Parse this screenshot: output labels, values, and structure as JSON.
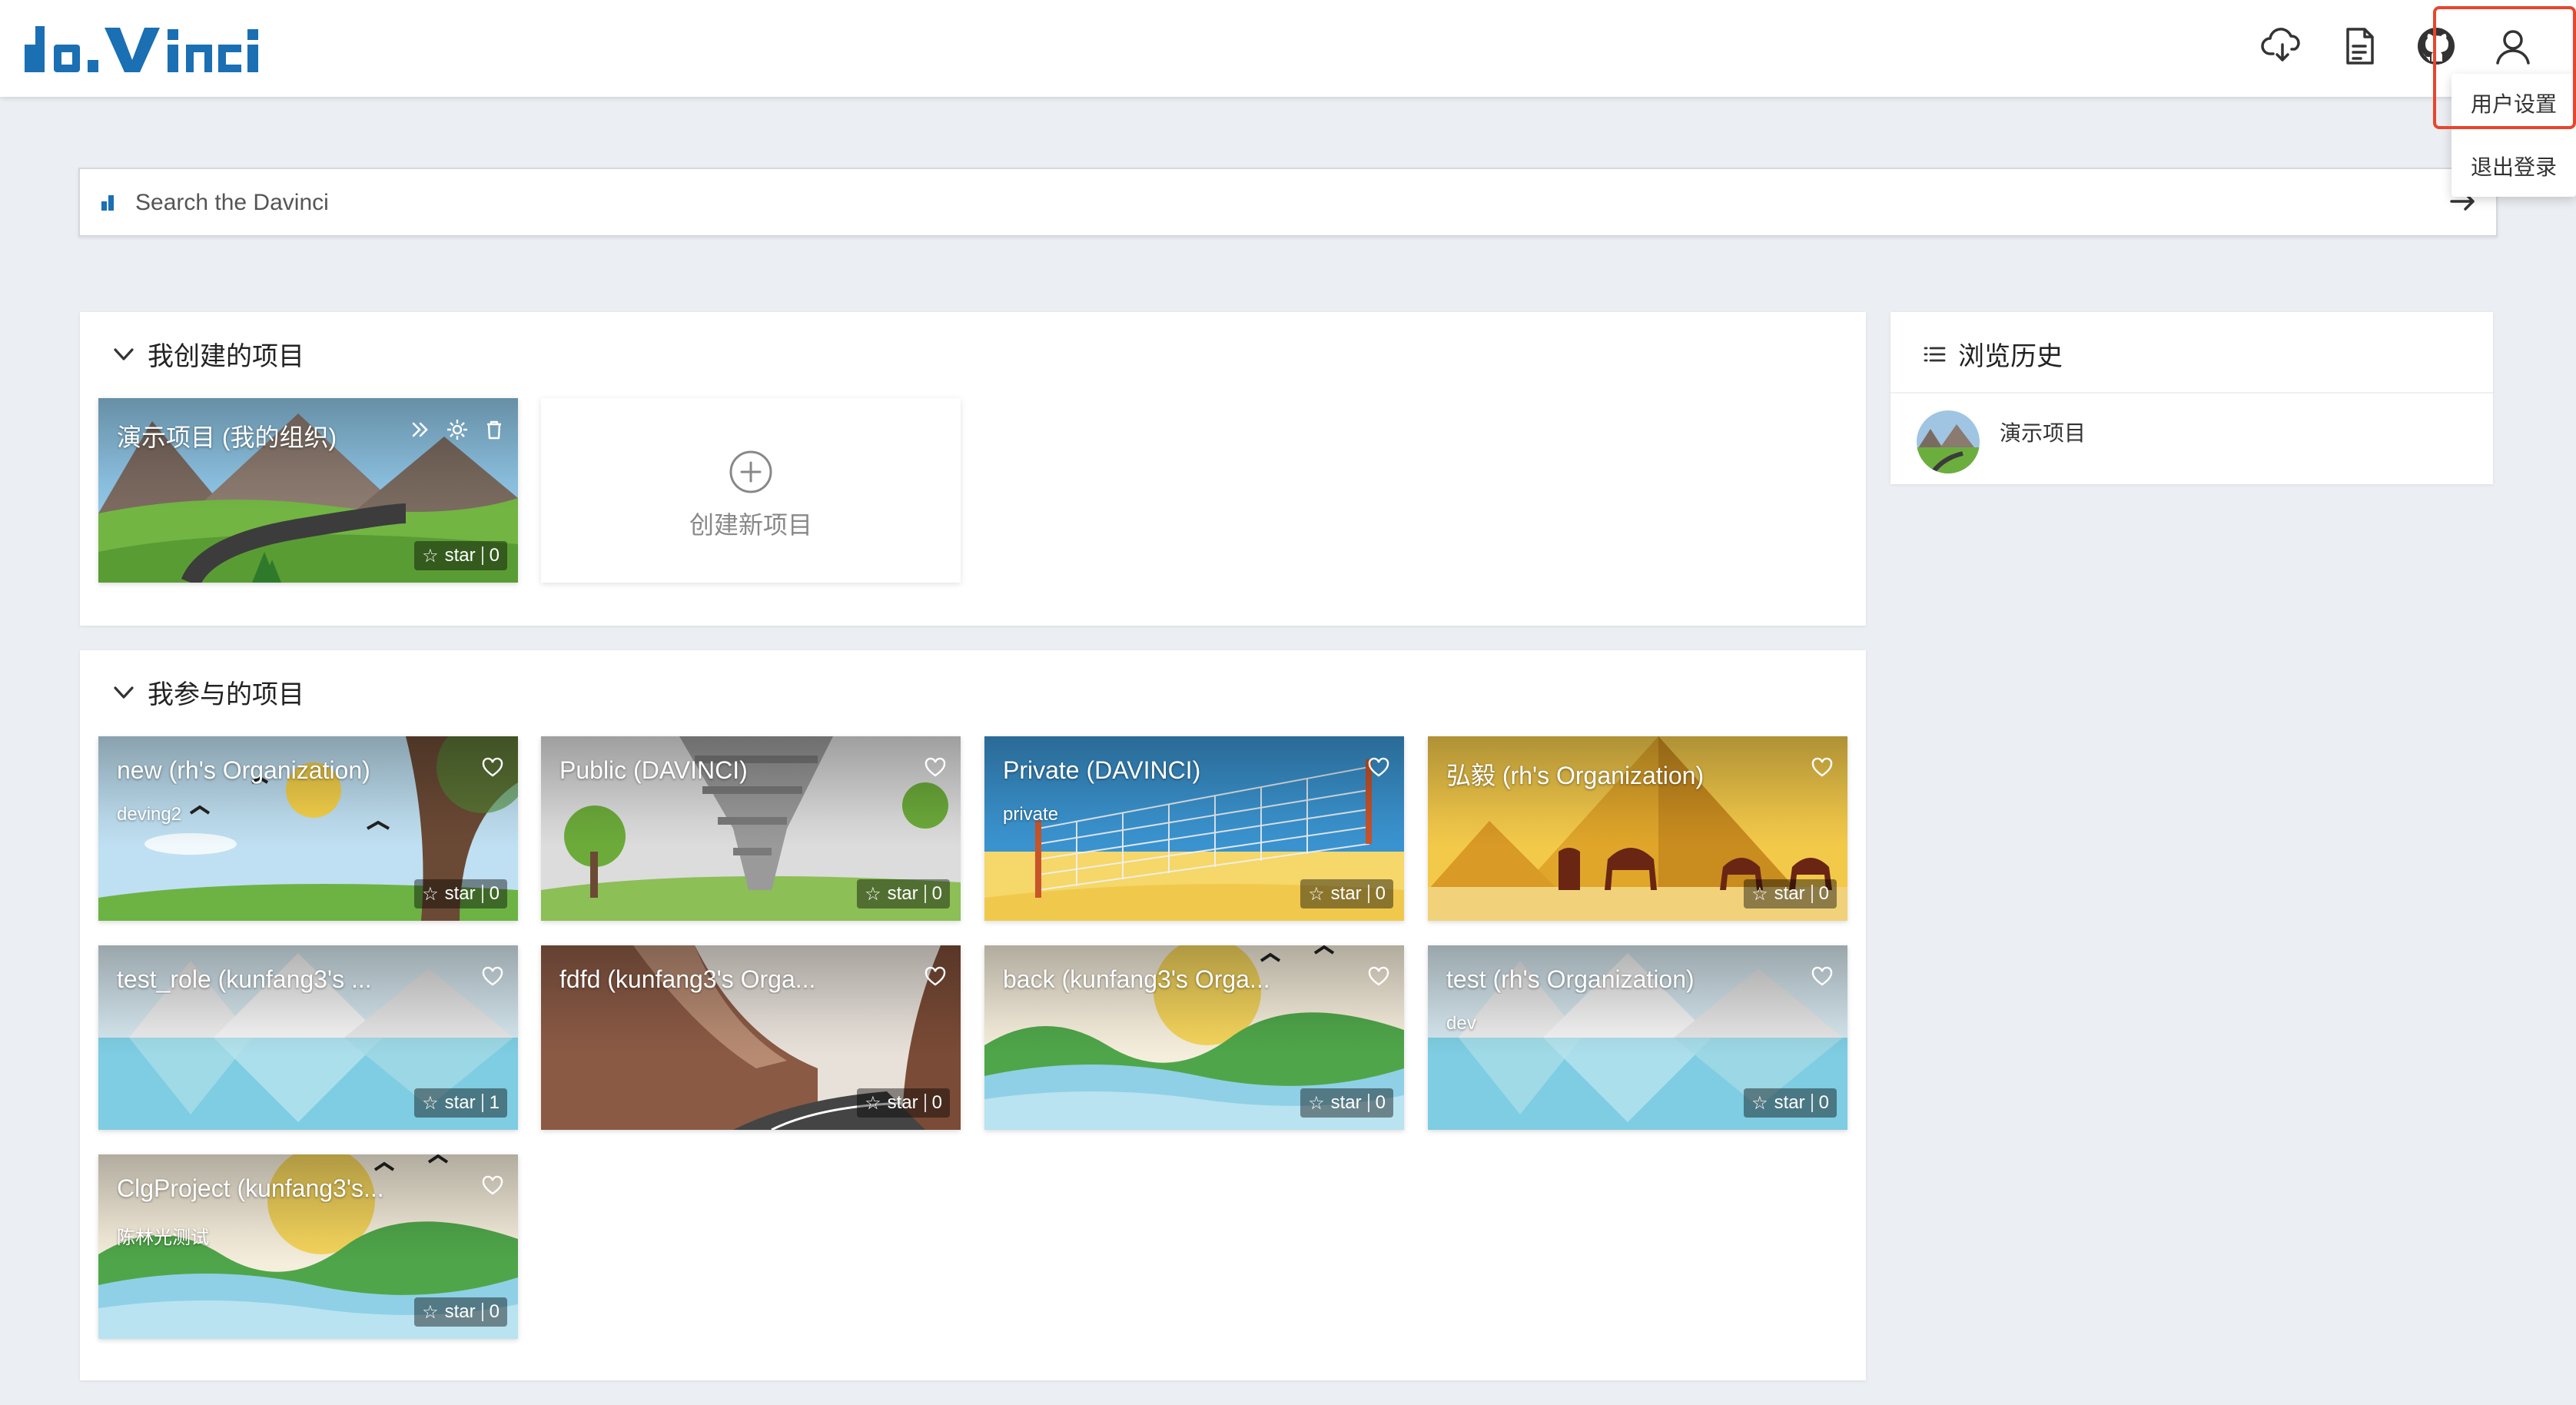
{
  "app": {
    "logo_text": "davinci"
  },
  "header": {
    "icons": [
      "cloud-download-icon",
      "document-icon",
      "github-icon",
      "user-icon"
    ],
    "user_menu": {
      "items": [
        "用户设置",
        "退出登录"
      ]
    }
  },
  "search": {
    "placeholder": "Search the Davinci"
  },
  "my_projects": {
    "title": "我创建的项目",
    "cards": [
      {
        "title": "演示项目 (我的组织)",
        "star_label": "star",
        "star_count": "0"
      }
    ],
    "create_label": "创建新项目"
  },
  "joined_projects": {
    "title": "我参与的项目",
    "cards": [
      {
        "title": "new (rh's Organization)",
        "subtitle": "deving2",
        "star_label": "star",
        "star_count": "0"
      },
      {
        "title": "Public (DAVINCI)",
        "subtitle": "",
        "star_label": "star",
        "star_count": "0"
      },
      {
        "title": "Private (DAVINCI)",
        "subtitle": "private",
        "star_label": "star",
        "star_count": "0"
      },
      {
        "title": "弘毅 (rh's Organization)",
        "subtitle": "",
        "star_label": "star",
        "star_count": "0"
      },
      {
        "title": "test_role (kunfang3's ...",
        "subtitle": "",
        "star_label": "star",
        "star_count": "1"
      },
      {
        "title": "fdfd (kunfang3's Orga...",
        "subtitle": "",
        "star_label": "star",
        "star_count": "0"
      },
      {
        "title": "back (kunfang3's Orga...",
        "subtitle": "",
        "star_label": "star",
        "star_count": "0"
      },
      {
        "title": "test (rh's Organization)",
        "subtitle": "dev",
        "star_label": "star",
        "star_count": "0"
      },
      {
        "title": "ClgProject (kunfang3's...",
        "subtitle": "陈林光测试",
        "star_label": "star",
        "star_count": "0"
      }
    ]
  },
  "history": {
    "title": "浏览历史",
    "items": [
      {
        "label": "演示项目"
      }
    ]
  },
  "colors": {
    "accent": "#1b6fb3",
    "highlight_border": "#e8462c",
    "background": "#ebeef2"
  }
}
